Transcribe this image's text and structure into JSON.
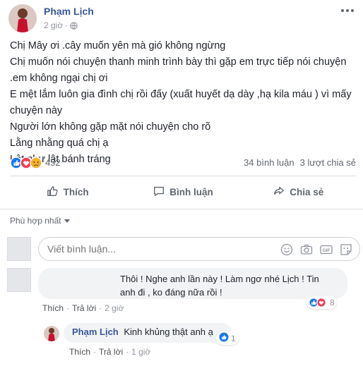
{
  "post": {
    "author": "Phạm Lịch",
    "time": "2 giờ",
    "privacy_icon": "globe-icon",
    "lines": [
      "Chị Mây ơi .cây muốn yên mà gió không ngừng",
      "Chị muốn nói chuyện thanh minh trình bày thì gặp em trực tiếp nói chuyện",
      ".em không ngại chị ơi",
      "E mệt lắm luôn gia đình chị rồi đấy (xuất huyết dạ dày ,hạ kila máu ) vì mấy",
      "chuyện này",
      "Người lớn không gặp mặt nói chuyện cho rõ",
      "Lằng nhằng quá chị ạ",
      "Lật như lật bánh tráng"
    ]
  },
  "reactions": {
    "count": "452",
    "comments": "34 bình luận",
    "shares": "3 lượt chia sẻ",
    "types": [
      "like",
      "love",
      "sad"
    ]
  },
  "actions": {
    "like": "Thích",
    "comment": "Bình luận",
    "share": "Chia sẻ"
  },
  "sort": {
    "label": "Phù hợp nhất"
  },
  "composer": {
    "placeholder": "Viết bình luận..."
  },
  "comment1": {
    "line1": "Thôi ! Nghe anh lần này ! Làm ngơ nhé Lịch ! Tin",
    "line2": "anh đi , ko đáng nữa rồi !",
    "like": "Thích",
    "reply": "Trả lời",
    "time": "2 giờ",
    "reaction_count": "8"
  },
  "reply1": {
    "author": "Phạm Lịch",
    "text": "Kinh khủng thật anh ạ",
    "like": "Thích",
    "reply": "Trả lời",
    "time": "1 giờ",
    "reaction_count": "1"
  },
  "colors": {
    "link": "#385898",
    "like_blue": "#1877f2",
    "love_red": "#f33e58",
    "sad_yellow": "#f7b125"
  }
}
